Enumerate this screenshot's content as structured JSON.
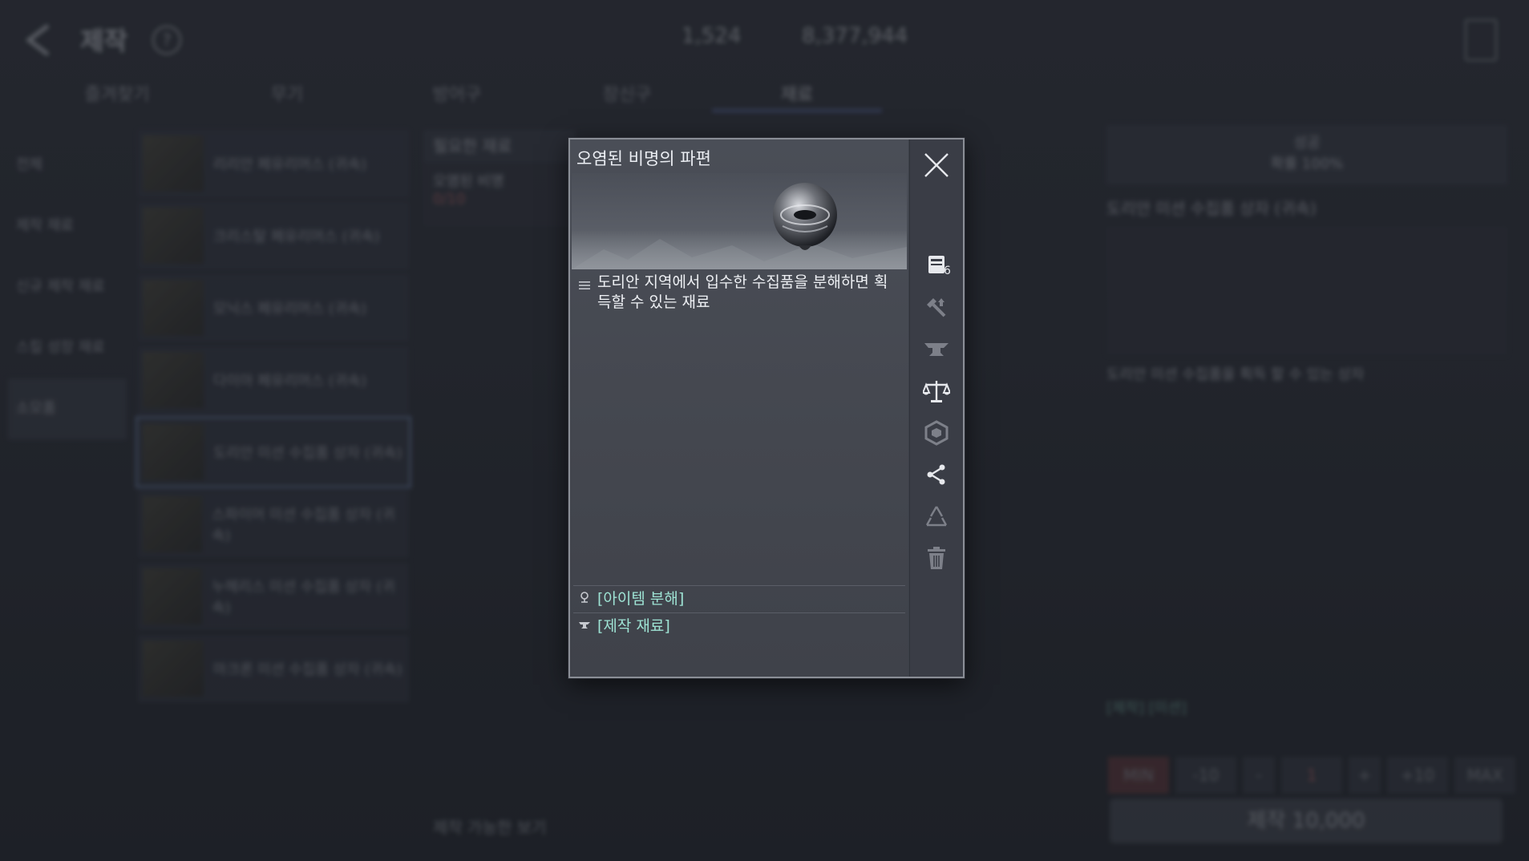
{
  "header": {
    "title": "제작",
    "help_symbol": "?",
    "currency_1": "1,524",
    "currency_2": "8,377,944"
  },
  "tabs": [
    {
      "label": "즐겨찾기"
    },
    {
      "label": "무기"
    },
    {
      "label": "방어구"
    },
    {
      "label": "장신구"
    },
    {
      "label": "재료"
    }
  ],
  "left_nav": [
    {
      "label": "전체"
    },
    {
      "label": "제작 재료"
    },
    {
      "label": "신규 제작 재료"
    },
    {
      "label": "스킬 성장 재료"
    },
    {
      "label": "소모품"
    }
  ],
  "item_list": [
    {
      "label": "리리안 페유리머스 (귀속)"
    },
    {
      "label": "크리스탈 페유리머스 (귀속)"
    },
    {
      "label": "모닉스 페유리머스 (귀속)"
    },
    {
      "label": "다이아 페유리머스 (귀속)"
    },
    {
      "label": "도리안 미션 수집품 상자 (귀속)"
    },
    {
      "label": "스파이어 미션 수집품 상자 (귀속)"
    },
    {
      "label": "누헤리스 미션 수집품 상자 (귀속)"
    },
    {
      "label": "마크론 미션 수집품 상자 (귀속)"
    }
  ],
  "materials_panel": {
    "header": "필요한 재료",
    "item_name": "오염된 비명",
    "count": "0/10"
  },
  "right_panel": {
    "header_line1": "성공",
    "header_line2": "확률 100%",
    "item_title": "도리안 미션 수집품 상자 (귀속)",
    "desc": "도리안 미션 수집품을 획득 할 수 있는 상자",
    "footer_link": "[제작] [미션]",
    "qty_buttons": [
      "MIN",
      "-10",
      "-",
      "1",
      "+",
      "+10",
      "MAX"
    ],
    "craft_label": "제작 10,000"
  },
  "bottom_toggle": "제작 가능한 보기",
  "modal": {
    "title": "오염된 비명의 파편",
    "description": "도리안 지역에서 입수한 수집품을 분해하면 획득할 수 있는 재료",
    "link_1": "[아이템 분해]",
    "link_2": "[제작 재료]",
    "side_badge": "6",
    "side_icons": [
      "codex-icon",
      "upgrade-hammer-icon",
      "anvil-icon",
      "scale-icon",
      "hexagon-icon",
      "share-icon",
      "recycle-icon",
      "trash-icon"
    ]
  },
  "colors": {
    "link": "#9ee3d4",
    "modal_bg": "#44474f",
    "tab_active_underline": "#5e6fa8"
  }
}
